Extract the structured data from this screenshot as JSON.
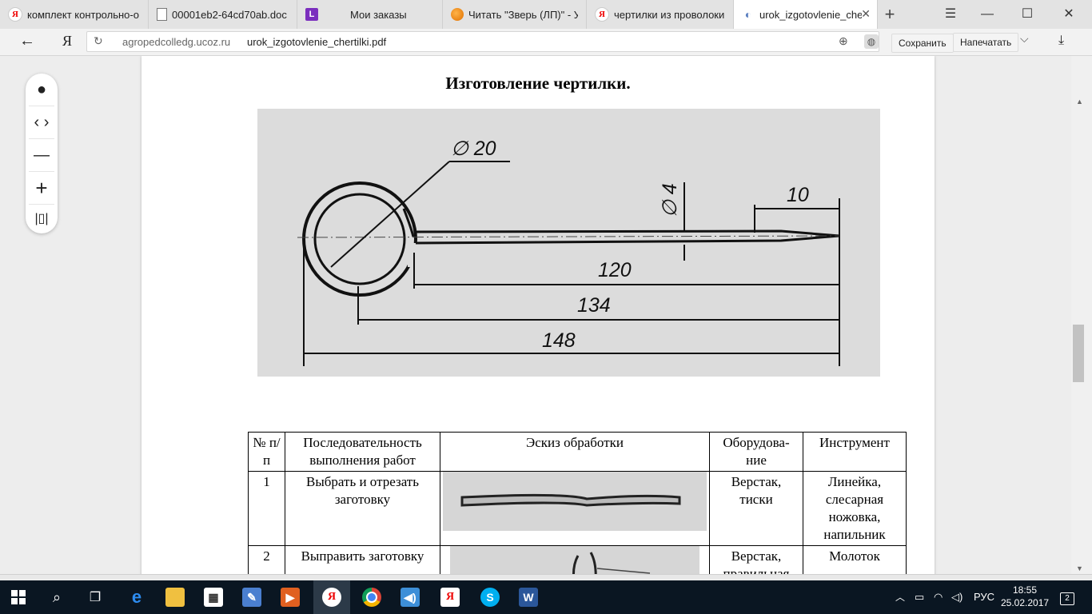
{
  "browser": {
    "tabs": [
      {
        "title": "комплект контрольно-о",
        "favicon": "yandex-icon"
      },
      {
        "title": "00001eb2-64cd70ab.doc",
        "favicon": "document-icon"
      },
      {
        "title": "Мои заказы",
        "favicon": "litres-icon",
        "favicon_text": "L"
      },
      {
        "title": "Читать \"Зверь (ЛП)\" - Ус",
        "favicon": "orange-globe-icon"
      },
      {
        "title": "чертилки из проволоки",
        "favicon": "yandex-icon"
      },
      {
        "title": "urok_izgotovlenie_cher",
        "favicon": "ucoz-icon",
        "active": true
      }
    ],
    "new_tab_glyph": "+",
    "address": {
      "host": "agropedcolledg.ucoz.ru",
      "path": "urok_izgotovlenie_chertilki.pdf"
    },
    "save_label": "Сохранить",
    "print_label": "Напечатать",
    "yandex_glyph": "Я"
  },
  "document": {
    "title": "Изготовление чертилки.",
    "drawing": {
      "dim_diameter": "∅ 20",
      "dim_wire": "∅ 4",
      "dim_tip": "10",
      "dim_shaft": "120",
      "dim_mid": "134",
      "dim_total": "148"
    },
    "table": {
      "headers": [
        "№ п/п",
        "Последовательность выполнения работ",
        "Эскиз обработки",
        "Оборудова-ние",
        "Инструмент"
      ],
      "rows": [
        {
          "num": "1",
          "step": "Выбрать и отрезать заготовку",
          "equipment": "Верстак, тиски",
          "tool": "Линейка, слесарная ножовка, напильник"
        },
        {
          "num": "2",
          "step": "Выправить заготовку",
          "equipment": "Верстак, правильная",
          "tool": "Молоток"
        }
      ]
    }
  },
  "taskbar": {
    "language": "РУС",
    "time": "18:55",
    "date": "25.02.2017",
    "notifications": "2"
  },
  "colors": {
    "taskbar_bg": "#0a1622",
    "tab_active_bg": "#ffffff",
    "litres_purple": "#7b2fbe",
    "yandex_red": "#e00000"
  }
}
